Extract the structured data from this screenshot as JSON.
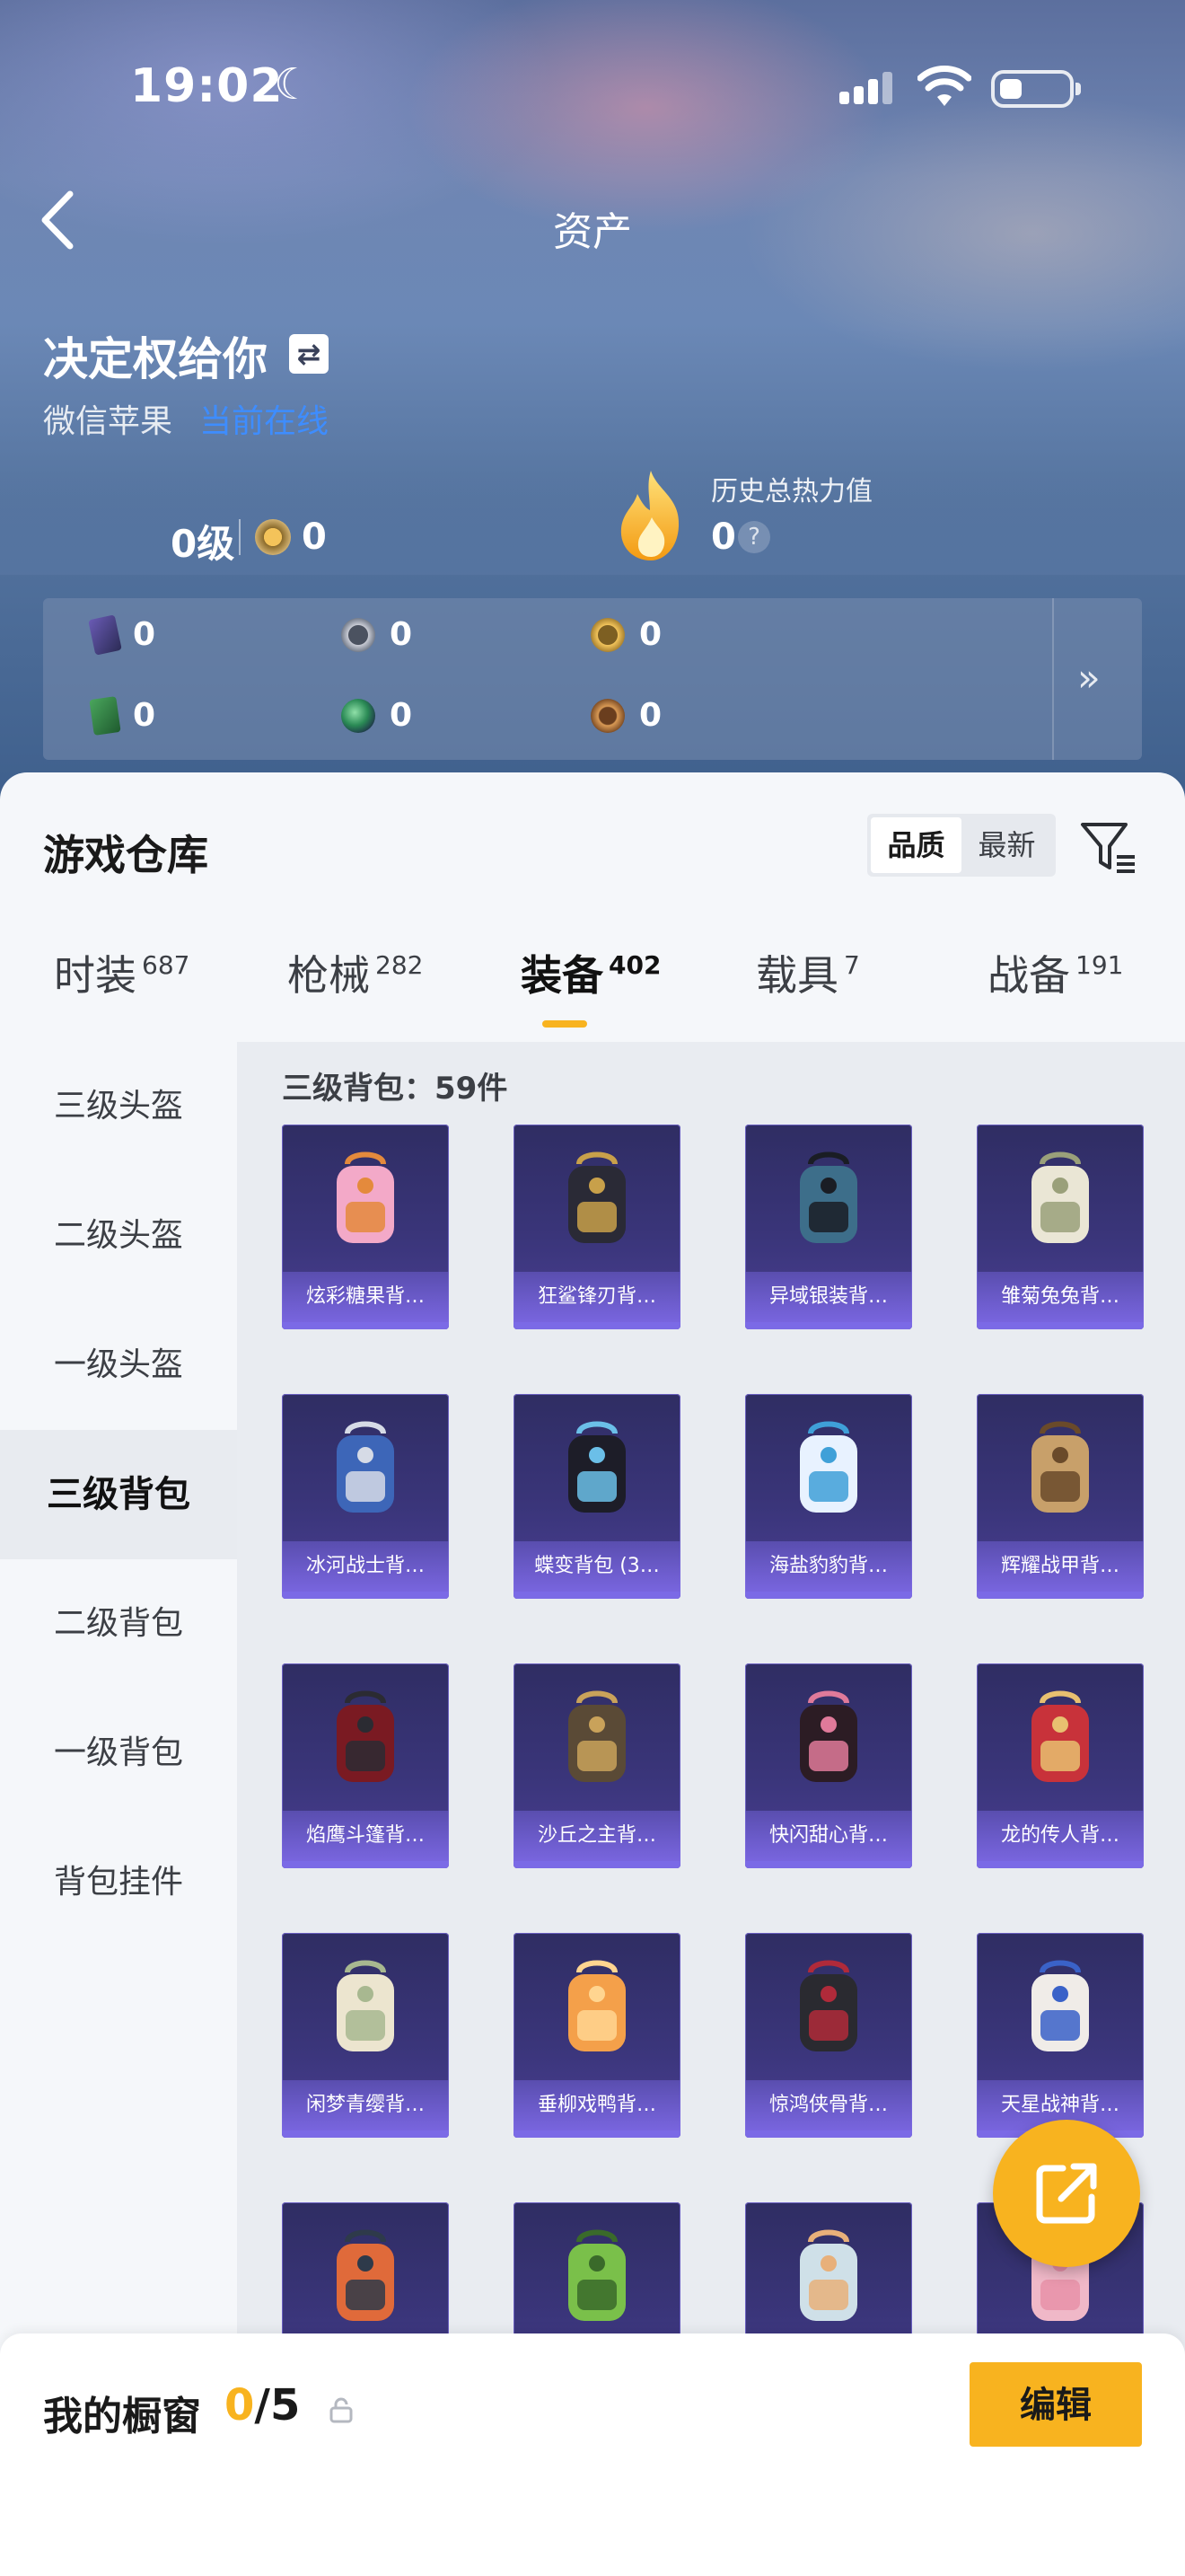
{
  "status_bar": {
    "time": "19:02"
  },
  "header": {
    "title": "资产",
    "player_name": "决定权给你",
    "platform": "微信苹果",
    "online_status": "当前在线"
  },
  "profile": {
    "level": "0级",
    "rank_value": "0",
    "heat_label": "历史总热力值",
    "heat_value": "0",
    "help_icon": "?"
  },
  "currencies": [
    {
      "icon": "purple-card-icon",
      "value": "0"
    },
    {
      "icon": "grey-coin-icon",
      "value": "0"
    },
    {
      "icon": "gold-coin-icon",
      "value": "0"
    },
    {
      "icon": "green-card-icon",
      "value": "0"
    },
    {
      "icon": "green-orb-icon",
      "value": "0"
    },
    {
      "icon": "bronze-coin-icon",
      "value": "0"
    }
  ],
  "warehouse": {
    "title": "游戏仓库",
    "sort_options": [
      "品质",
      "最新"
    ],
    "sort_selected": "品质",
    "tabs": [
      {
        "label": "时装",
        "count": "687"
      },
      {
        "label": "枪械",
        "count": "282"
      },
      {
        "label": "装备",
        "count": "402"
      },
      {
        "label": "载具",
        "count": "7"
      },
      {
        "label": "战备",
        "count": "191"
      }
    ],
    "active_tab": "装备",
    "categories": [
      "三级头盔",
      "二级头盔",
      "一级头盔",
      "三级背包",
      "二级背包",
      "一级背包",
      "背包挂件"
    ],
    "active_category": "三级背包",
    "section_label": "三级背包：59件",
    "items": [
      {
        "name": "炫彩糖果背…"
      },
      {
        "name": "狂鲨锋刃背…"
      },
      {
        "name": "异域银装背…"
      },
      {
        "name": "雏菊兔兔背…"
      },
      {
        "name": "冰河战士背…"
      },
      {
        "name": "蝶变背包 (3…"
      },
      {
        "name": "海盐豹豹背…"
      },
      {
        "name": "辉耀战甲背…"
      },
      {
        "name": "焰鹰斗篷背…"
      },
      {
        "name": "沙丘之主背…"
      },
      {
        "name": "快闪甜心背…"
      },
      {
        "name": "龙的传人背…"
      },
      {
        "name": "闲梦青缨背…"
      },
      {
        "name": "垂柳戏鸭背…"
      },
      {
        "name": "惊鸿侠骨背…"
      },
      {
        "name": "天星战神背…"
      }
    ]
  },
  "showcase": {
    "title": "我的橱窗",
    "current": "0",
    "total": "/5",
    "edit_label": "编辑"
  }
}
